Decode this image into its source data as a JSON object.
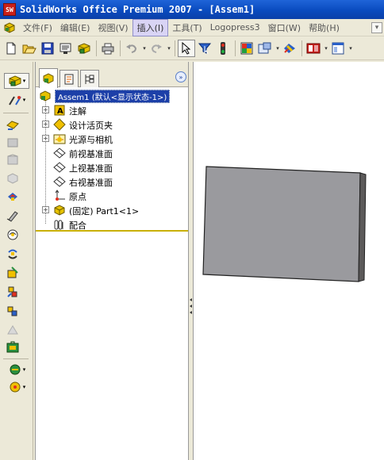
{
  "window": {
    "title": "SolidWorks Office Premium 2007 - [Assem1]",
    "app_icon_text": "SW"
  },
  "menu": {
    "items": [
      {
        "label": "文件(F)",
        "active": false
      },
      {
        "label": "编辑(E)",
        "active": false
      },
      {
        "label": "视图(V)",
        "active": false
      },
      {
        "label": "插入(I)",
        "active": true
      },
      {
        "label": "工具(T)",
        "active": false
      },
      {
        "label": "Logopress3",
        "active": false
      },
      {
        "label": "窗口(W)",
        "active": false
      },
      {
        "label": "帮助(H)",
        "active": false
      }
    ]
  },
  "toolbar": {
    "buttons": [
      "new-icon",
      "open-icon",
      "save-icon",
      "print-preview-icon",
      "assembly-from-part-icon",
      "print-icon",
      "undo-icon",
      "redo-icon",
      "select-icon",
      "select-filter-icon",
      "traffic-light-icon",
      "grid-icon",
      "display-style-icon",
      "rebuild-icon",
      "solidworks-resources-icon",
      "window-layout-icon"
    ]
  },
  "leftbar": {
    "buttons": [
      "insert-component-icon",
      "mate-icon",
      "assembly-features-icon",
      "smart-fasteners-icon",
      "move-component-icon",
      "hide-components-icon",
      "exploded-view-icon",
      "interference-detection-icon",
      "show-hidden-icon",
      "rotate-component-icon",
      "edit-component-icon",
      "bill-of-materials-icon",
      "explode-line-icon",
      "reference-geometry-icon",
      "toolbox-icon",
      "photoworks-icon"
    ]
  },
  "feature_tree": {
    "root": "Assem1  (默认<显示状态-1>)",
    "items": [
      {
        "label": "注解",
        "icon": "annotations-icon",
        "expandable": true
      },
      {
        "label": "设计活页夹",
        "icon": "design-binder-icon",
        "expandable": true
      },
      {
        "label": "光源与相机",
        "icon": "lights-cameras-icon",
        "expandable": true
      },
      {
        "label": "前视基准面",
        "icon": "plane-icon",
        "expandable": false
      },
      {
        "label": "上视基准面",
        "icon": "plane-icon",
        "expandable": false
      },
      {
        "label": "右视基准面",
        "icon": "plane-icon",
        "expandable": false
      },
      {
        "label": "原点",
        "icon": "origin-icon",
        "expandable": false
      },
      {
        "label": "(固定) Part1<1>",
        "icon": "part-icon",
        "expandable": true
      },
      {
        "label": "配合",
        "icon": "mates-folder-icon",
        "expandable": false
      }
    ]
  },
  "colors": {
    "title_bar": "#0a4bbf",
    "part_face": "#9a9a9e",
    "selection": "#1c3fa8",
    "rollback_bar": "#c9b000"
  }
}
